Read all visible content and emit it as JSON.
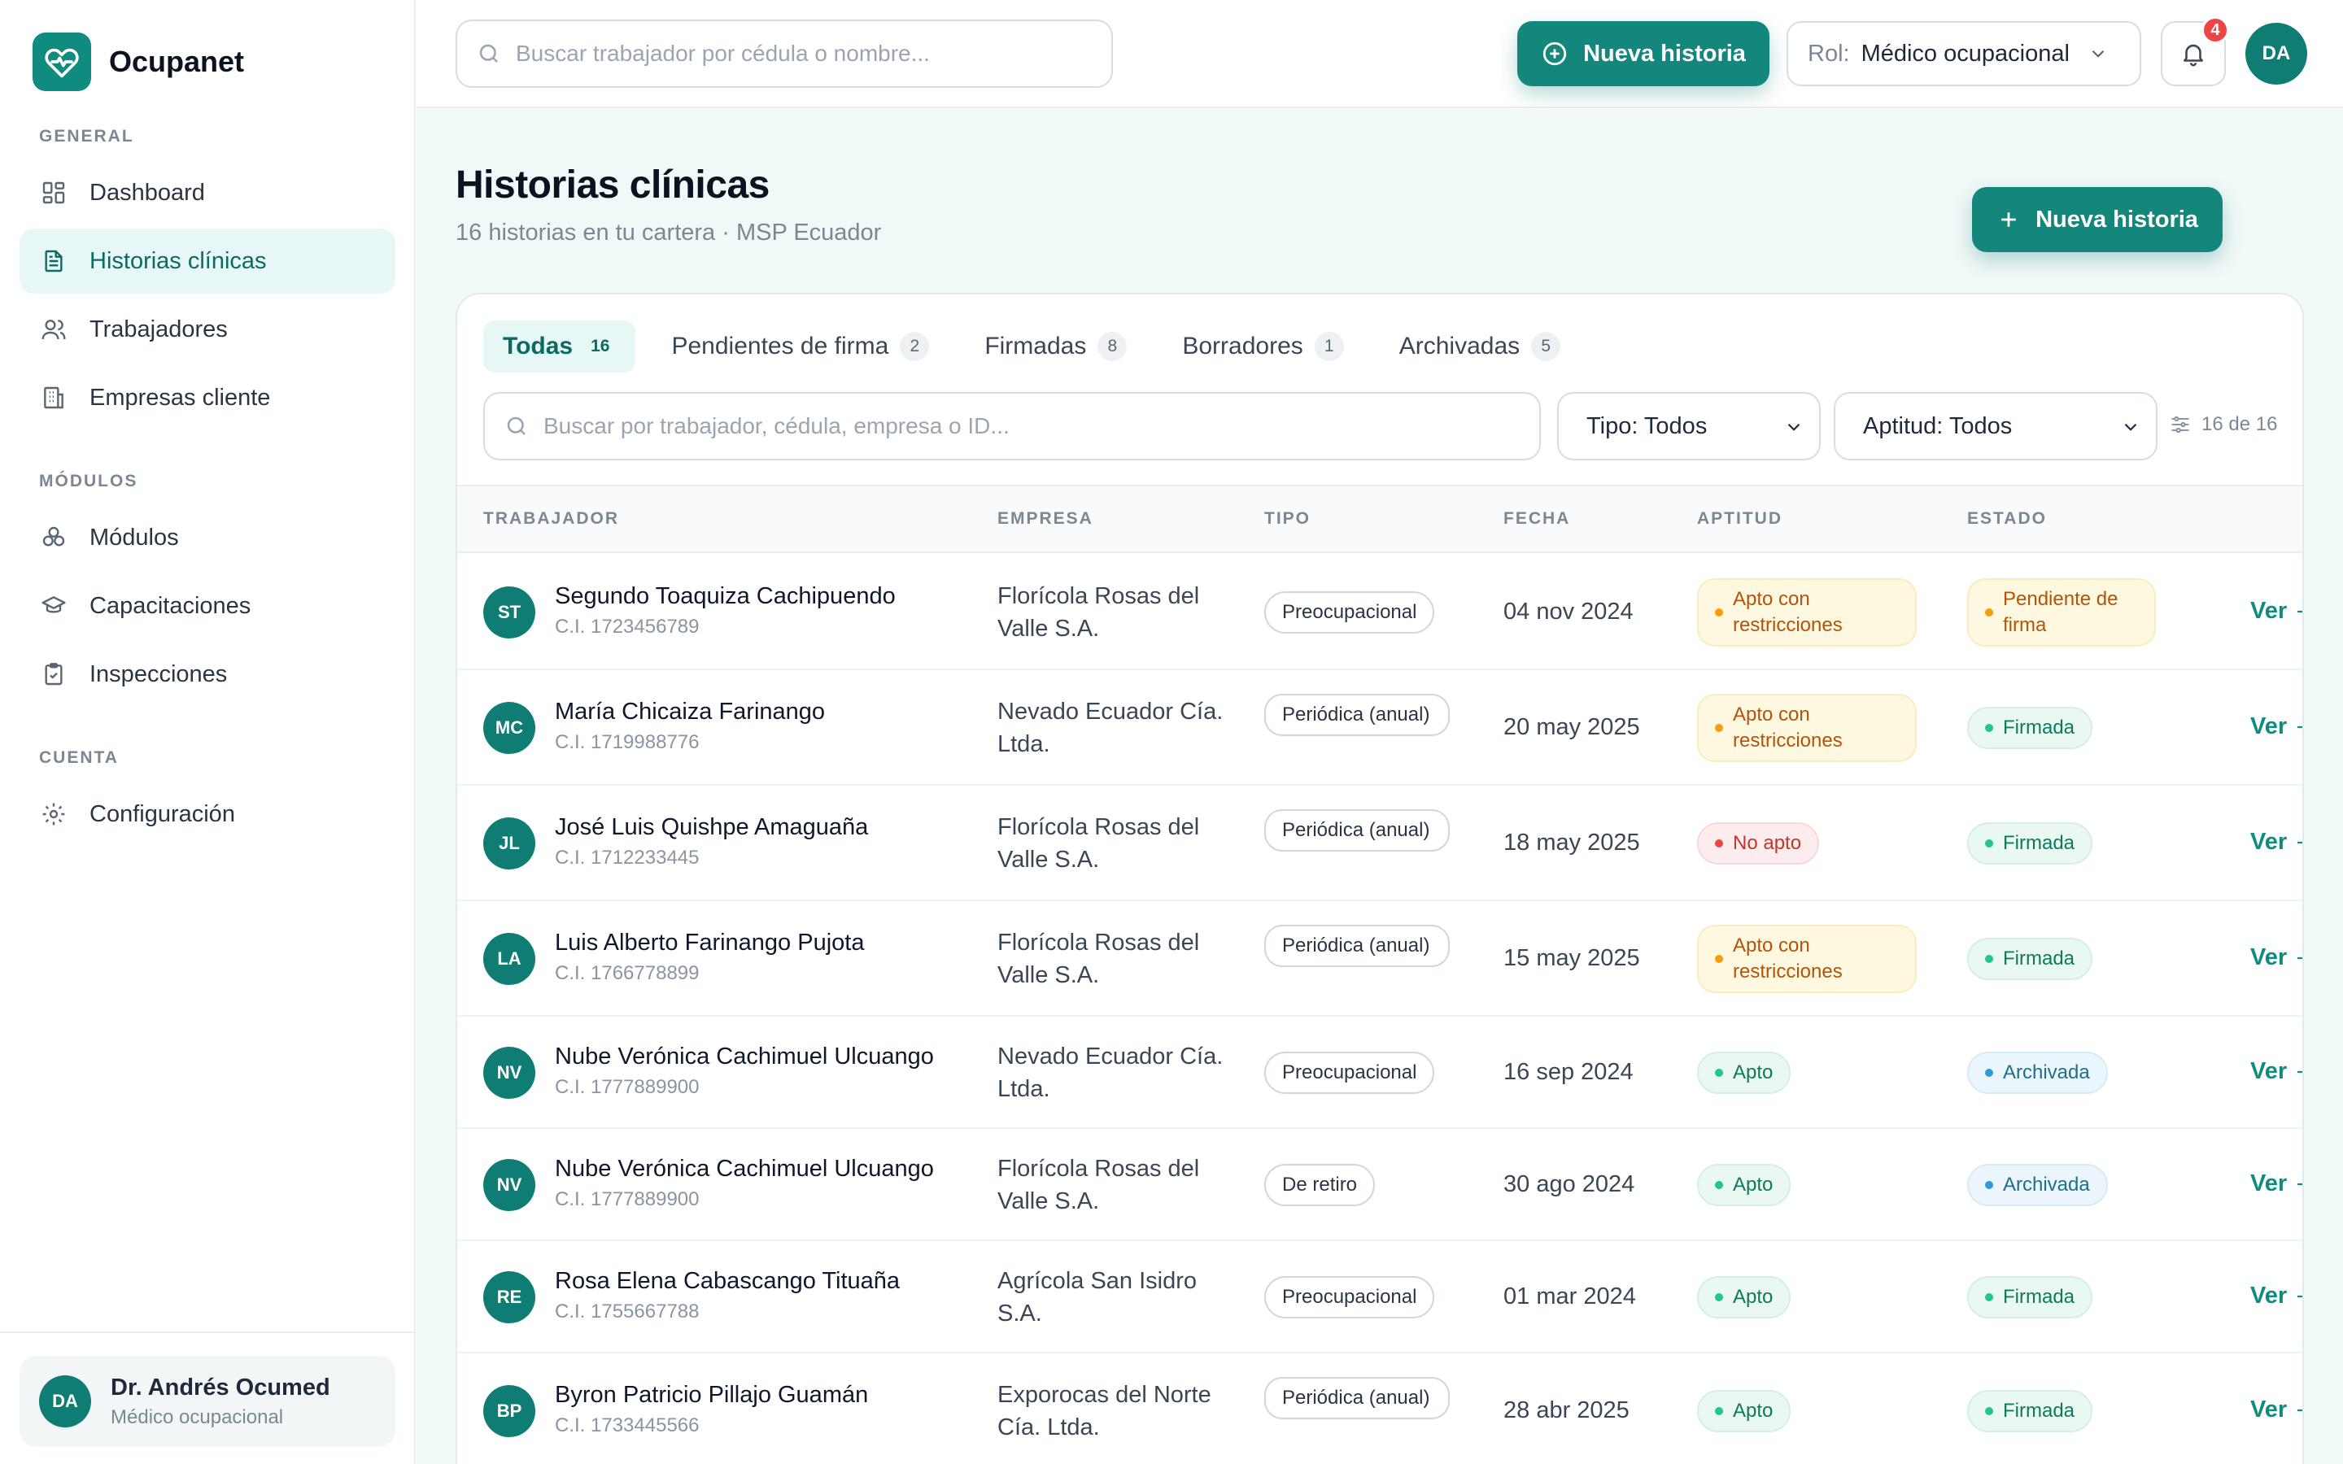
{
  "brand": {
    "name": "Ocupanet",
    "icon": "heart-pulse-icon",
    "color": "#0f8b80"
  },
  "sidebar": {
    "sections": [
      {
        "title": "GENERAL",
        "items": [
          {
            "label": "Dashboard",
            "icon": "grid-icon",
            "active": false
          },
          {
            "label": "Historias clínicas",
            "icon": "document-icon",
            "active": true
          },
          {
            "label": "Trabajadores",
            "icon": "users-icon",
            "active": false
          },
          {
            "label": "Empresas cliente",
            "icon": "building-icon",
            "active": false
          }
        ]
      },
      {
        "title": "MÓDULOS",
        "items": [
          {
            "label": "Módulos",
            "icon": "modules-icon",
            "active": false
          },
          {
            "label": "Capacitaciones",
            "icon": "graduation-cap-icon",
            "active": false
          },
          {
            "label": "Inspecciones",
            "icon": "clipboard-check-icon",
            "active": false
          }
        ]
      },
      {
        "title": "CUENTA",
        "items": [
          {
            "label": "Configuración",
            "icon": "gear-icon",
            "active": false
          }
        ]
      }
    ],
    "user": {
      "initials": "DA",
      "name": "Dr. Andrés Ocumed",
      "role": "Médico ocupacional"
    }
  },
  "topbar": {
    "search_placeholder": "Buscar trabajador por cédula o nombre...",
    "new_button": "Nueva historia",
    "role_label": "Rol:",
    "role_value": "Médico ocupacional",
    "notifications": "4",
    "avatar": "DA"
  },
  "page": {
    "title": "Historias clínicas",
    "subtitle": "16 historias en tu cartera · MSP Ecuador",
    "new_button": "Nueva historia"
  },
  "tabs": [
    {
      "label": "Todas",
      "count": "16",
      "active": true
    },
    {
      "label": "Pendientes de firma",
      "count": "2",
      "active": false
    },
    {
      "label": "Firmadas",
      "count": "8",
      "active": false
    },
    {
      "label": "Borradores",
      "count": "1",
      "active": false
    },
    {
      "label": "Archivadas",
      "count": "5",
      "active": false
    }
  ],
  "filters": {
    "search_placeholder": "Buscar por trabajador, cédula, empresa o ID...",
    "type": "Tipo: Todos",
    "aptitude": "Aptitud: Todos",
    "result_count": "16 de 16"
  },
  "table": {
    "columns": [
      "TRABAJADOR",
      "EMPRESA",
      "TIPO",
      "FECHA",
      "APTITUD",
      "ESTADO"
    ],
    "view_label": "Ver",
    "rows": [
      {
        "initials": "ST",
        "name": "Segundo Toaquiza Cachipuendo",
        "ci": "C.I. 1723456789",
        "company": "Florícola Rosas del Valle S.A.",
        "type": "Preocupacional",
        "date": "04 nov 2024",
        "aptitude": "Apto con restricciones",
        "aptitude_tone": "amber",
        "status": "Pendiente de firma",
        "status_tone": "amber"
      },
      {
        "initials": "MC",
        "name": "María Chicaiza Farinango",
        "ci": "C.I. 1719988776",
        "company": "Nevado Ecuador Cía. Ltda.",
        "type": "Periódica (anual)",
        "date": "20 may 2025",
        "aptitude": "Apto con restricciones",
        "aptitude_tone": "amber",
        "status": "Firmada",
        "status_tone": "green"
      },
      {
        "initials": "JL",
        "name": "José Luis Quishpe Amaguaña",
        "ci": "C.I. 1712233445",
        "company": "Florícola Rosas del Valle S.A.",
        "type": "Periódica (anual)",
        "date": "18 may 2025",
        "aptitude": "No apto",
        "aptitude_tone": "red",
        "status": "Firmada",
        "status_tone": "green"
      },
      {
        "initials": "LA",
        "name": "Luis Alberto Farinango Pujota",
        "ci": "C.I. 1766778899",
        "company": "Florícola Rosas del Valle S.A.",
        "type": "Periódica (anual)",
        "date": "15 may 2025",
        "aptitude": "Apto con restricciones",
        "aptitude_tone": "amber",
        "status": "Firmada",
        "status_tone": "green"
      },
      {
        "initials": "NV",
        "name": "Nube Verónica Cachimuel Ulcuango",
        "ci": "C.I. 1777889900",
        "company": "Nevado Ecuador Cía. Ltda.",
        "type": "Preocupacional",
        "date": "16 sep 2024",
        "aptitude": "Apto",
        "aptitude_tone": "green",
        "status": "Archivada",
        "status_tone": "blue"
      },
      {
        "initials": "NV",
        "name": "Nube Verónica Cachimuel Ulcuango",
        "ci": "C.I. 1777889900",
        "company": "Florícola Rosas del Valle S.A.",
        "type": "De retiro",
        "date": "30 ago 2024",
        "aptitude": "Apto",
        "aptitude_tone": "green",
        "status": "Archivada",
        "status_tone": "blue"
      },
      {
        "initials": "RE",
        "name": "Rosa Elena Cabascango Tituaña",
        "ci": "C.I. 1755667788",
        "company": "Agrícola San Isidro S.A.",
        "type": "Preocupacional",
        "date": "01 mar 2024",
        "aptitude": "Apto",
        "aptitude_tone": "green",
        "status": "Firmada",
        "status_tone": "green"
      },
      {
        "initials": "BP",
        "name": "Byron Patricio Pillajo Guamán",
        "ci": "C.I. 1733445566",
        "company": "Exporocas del Norte Cía. Ltda.",
        "type": "Periódica (anual)",
        "date": "28 abr 2025",
        "aptitude": "Apto",
        "aptitude_tone": "green",
        "status": "Firmada",
        "status_tone": "green"
      }
    ]
  }
}
